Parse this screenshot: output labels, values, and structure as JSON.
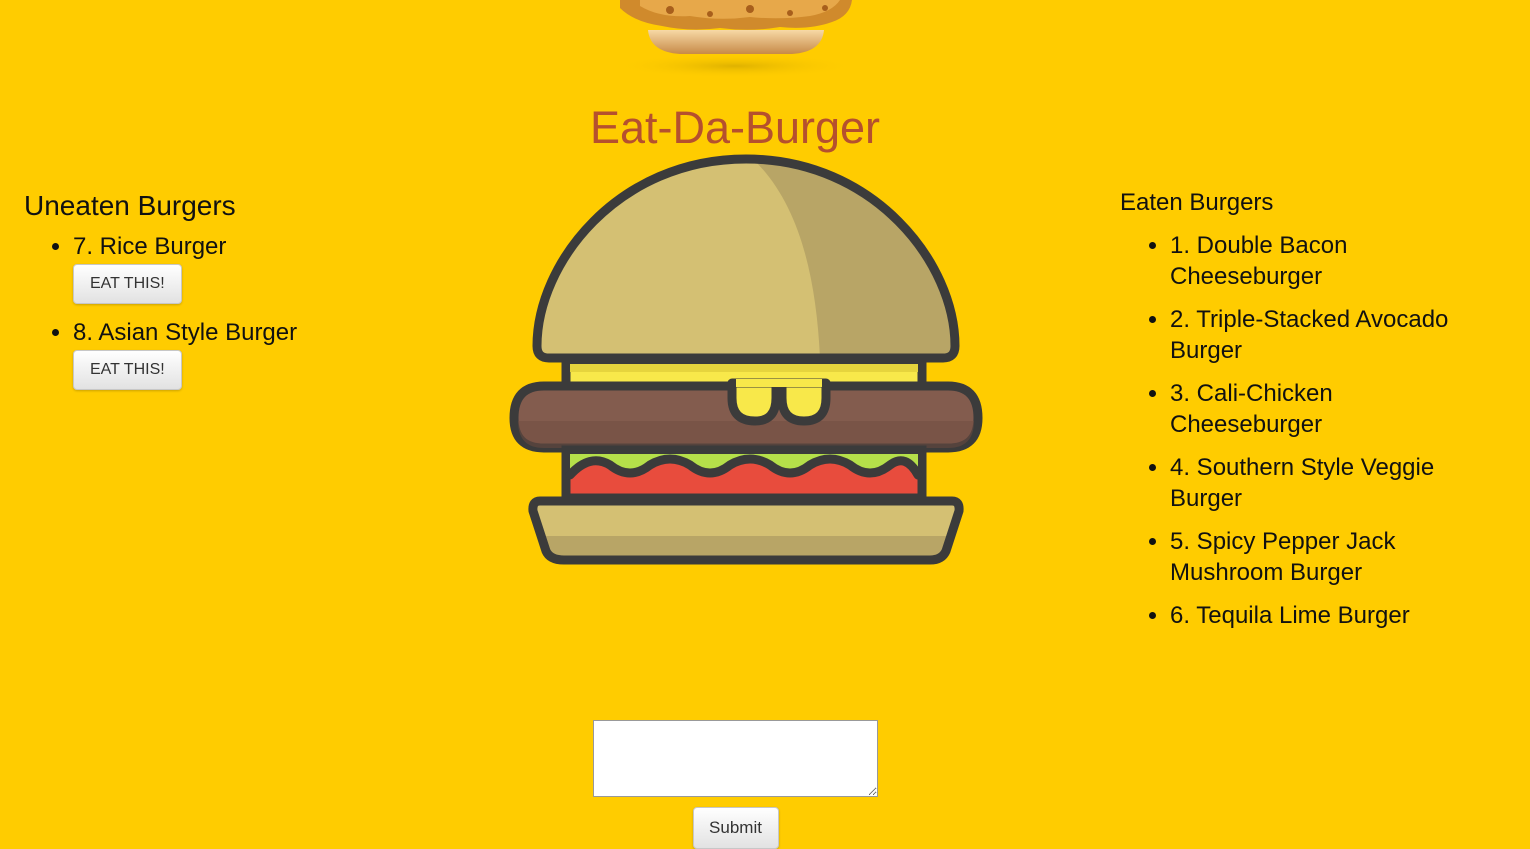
{
  "page": {
    "title": "Eat-Da-Burger"
  },
  "uneaten": {
    "heading": "Uneaten Burgers",
    "button_label": "EAT THIS!",
    "items": [
      {
        "label": "7. Rice Burger",
        "button": "EAT THIS!"
      },
      {
        "label": "8. Asian Style Burger",
        "button": "EAT THIS!"
      }
    ]
  },
  "eaten": {
    "heading": "Eaten Burgers",
    "items": [
      "1. Double Bacon Cheeseburger",
      "2. Triple-Stacked Avocado Burger",
      "3. Cali-Chicken Cheeseburger",
      "4. Southern Style Veggie Burger",
      "5. Spicy Pepper Jack Mushroom Burger",
      "6. Tequila Lime Burger"
    ]
  },
  "form": {
    "input_value": "",
    "submit_label": "Submit"
  },
  "colors": {
    "background": "#ffcc00",
    "title": "#b5502e",
    "bun": "#d4c073",
    "bun_shade": "#b8a566",
    "patty": "#835c4e",
    "cheese": "#f8e84a",
    "lettuce": "#b5e04a",
    "tomato": "#e84c3d",
    "outline": "#3b3b3b"
  },
  "icons": {
    "top_photo": "crispy-chicken-burger-photo",
    "hero": "burger-illustration"
  }
}
